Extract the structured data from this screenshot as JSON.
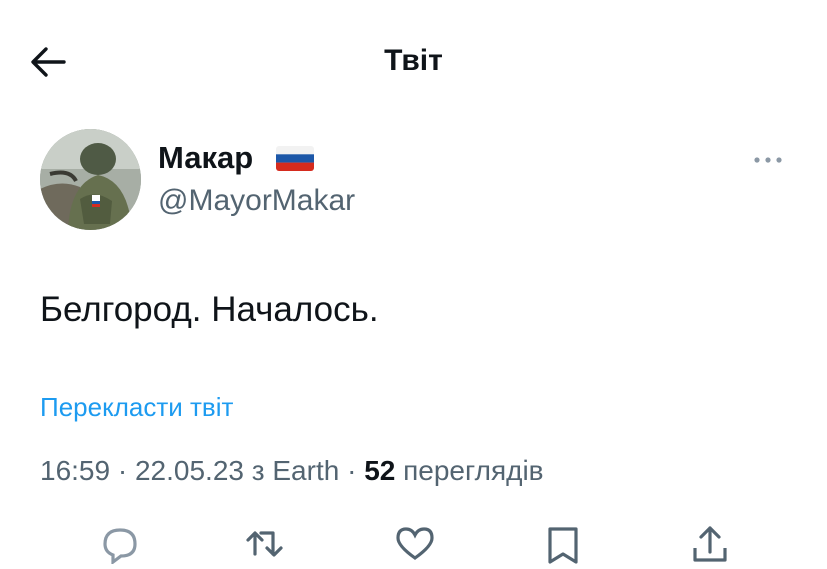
{
  "header": {
    "title": "Твіт"
  },
  "tweet": {
    "author_name": "Макар",
    "author_flag": "russia-flag-icon",
    "handle": "@MayorMakar",
    "text": "Белгород. Началось.",
    "translate_label": "Перекласти твіт",
    "time": "16:59",
    "date": "22.05.23",
    "source": "з Earth",
    "separator": "·",
    "views_count": "52",
    "views_label": "переглядів"
  },
  "actions": [
    "reply-icon",
    "retweet-icon",
    "like-icon",
    "bookmark-icon",
    "share-icon"
  ],
  "colors": {
    "link": "#1d9bf0",
    "secondary_text": "#536471",
    "primary_text": "#0f1419"
  }
}
